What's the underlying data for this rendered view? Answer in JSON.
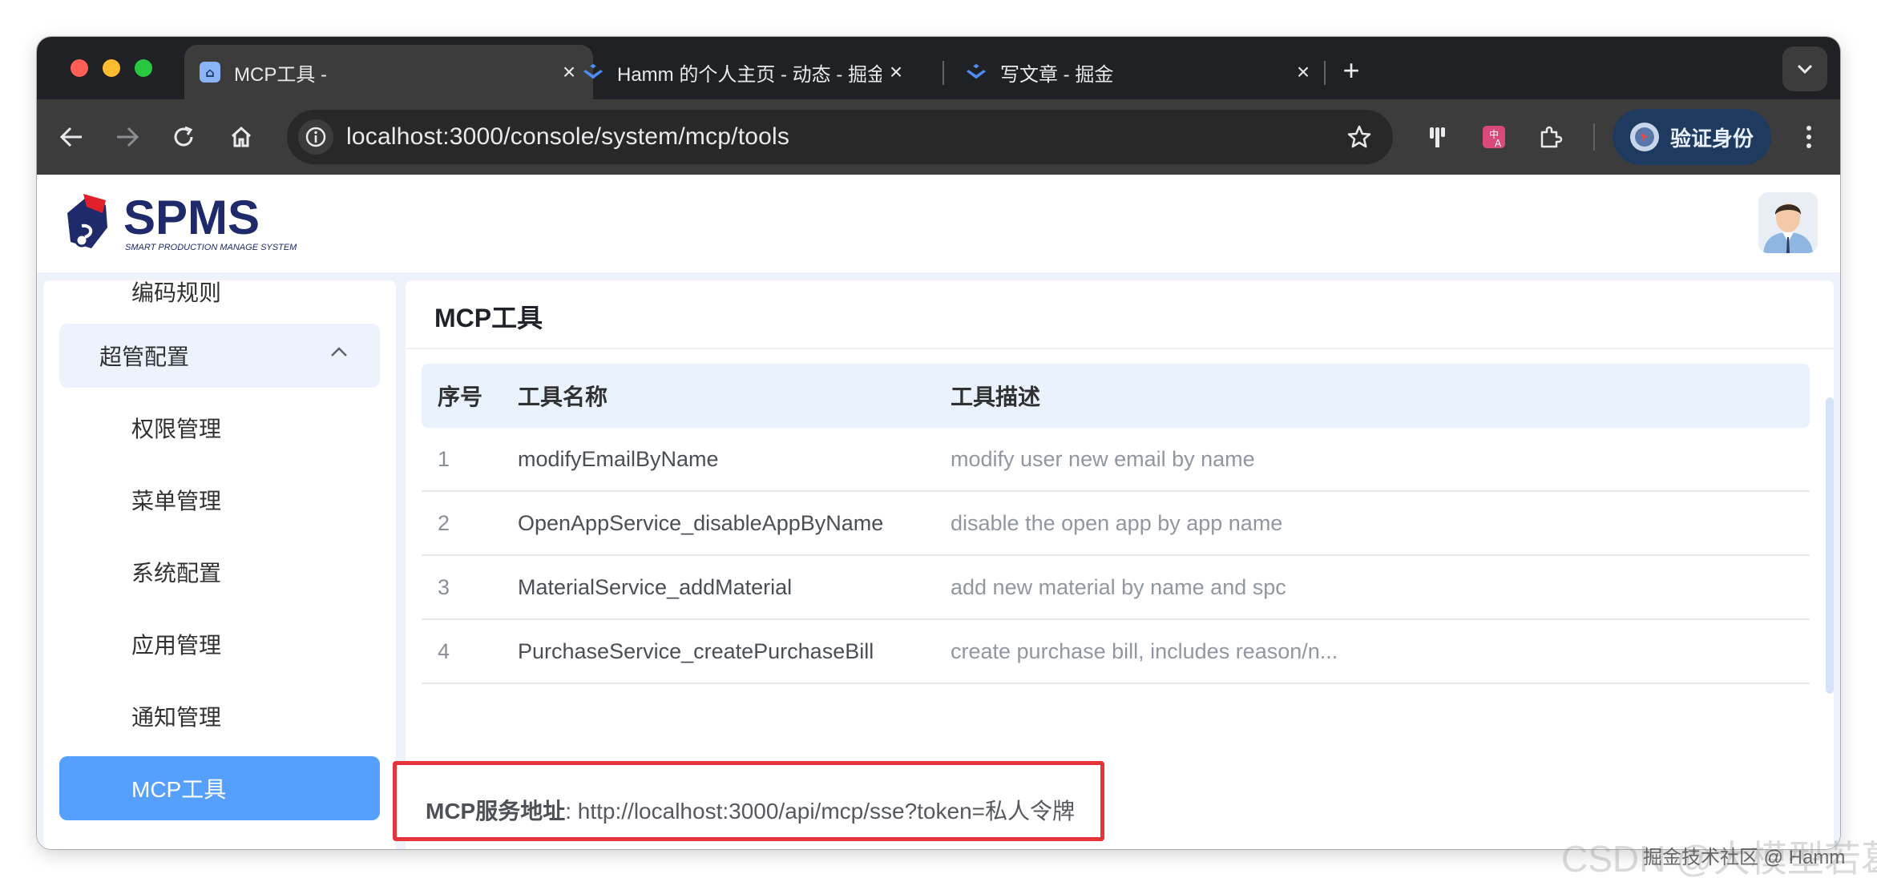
{
  "browser": {
    "tabs": [
      {
        "title": "MCP工具 -",
        "active": true
      },
      {
        "title": "Hamm 的个人主页 - 动态 - 掘金",
        "active": false
      },
      {
        "title": "写文章 - 掘金",
        "active": false
      }
    ],
    "url": "localhost:3000/console/system/mcp/tools",
    "profile_button": "验证身份"
  },
  "app": {
    "logo_text": "SPMS",
    "logo_subtitle": "SMART PRODUCTION MANAGE SYSTEM"
  },
  "sidebar": {
    "items": [
      {
        "label": "编码规则",
        "type": "item"
      },
      {
        "label": "超管配置",
        "type": "group",
        "expanded": true
      },
      {
        "label": "权限管理",
        "type": "item"
      },
      {
        "label": "菜单管理",
        "type": "item"
      },
      {
        "label": "系统配置",
        "type": "item"
      },
      {
        "label": "应用管理",
        "type": "item"
      },
      {
        "label": "通知管理",
        "type": "item"
      },
      {
        "label": "MCP工具",
        "type": "item",
        "active": true
      }
    ]
  },
  "content": {
    "title": "MCP工具",
    "table": {
      "headers": [
        "序号",
        "工具名称",
        "工具描述"
      ],
      "rows": [
        [
          "1",
          "modifyEmailByName",
          "modify user new email by name"
        ],
        [
          "2",
          "OpenAppService_disableAppByName",
          "disable the open app by app name"
        ],
        [
          "3",
          "MaterialService_addMaterial",
          "add new material by name and spc"
        ],
        [
          "4",
          "PurchaseService_createPurchaseBill",
          "create purchase bill, includes reason/n..."
        ]
      ]
    },
    "mcp_service": {
      "label": "MCP服务地址",
      "value": ": http://localhost:3000/api/mcp/sse?token=私人令牌"
    }
  },
  "watermark": {
    "csdn": "CSDN @大模型若葛",
    "juejin": "掘金技术社区 @ Hamm"
  },
  "colors": {
    "accent": "#55a0fd",
    "highlight_border": "#e5353b",
    "browser_dark": "#202124"
  }
}
